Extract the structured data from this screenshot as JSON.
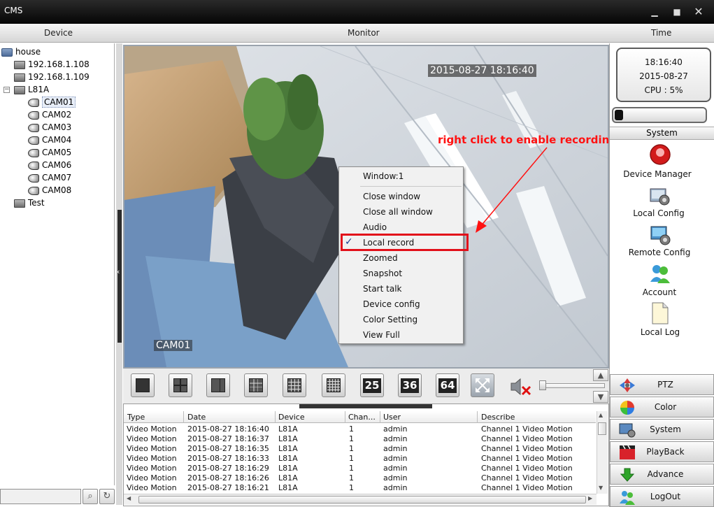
{
  "window": {
    "title": "CMS"
  },
  "headers": {
    "device": "Device",
    "monitor": "Monitor",
    "time": "Time"
  },
  "tree": {
    "root": "house",
    "devices": [
      "192.168.1.108",
      "192.168.1.109"
    ],
    "group": "L81A",
    "cameras": [
      "CAM01",
      "CAM02",
      "CAM03",
      "CAM04",
      "CAM05",
      "CAM06",
      "CAM07",
      "CAM08"
    ],
    "other": "Test",
    "selected": "CAM01"
  },
  "video": {
    "timestamp": "2015-08-27 18:16:40",
    "camera_label": "CAM01"
  },
  "context_menu": {
    "items": [
      "Window:1",
      "Close window",
      "Close all window",
      "Audio",
      "Local record",
      "Zoomed",
      "Snapshot",
      "Start talk",
      "Device config",
      "Color Setting",
      "View Full"
    ],
    "checked": "Local record",
    "check_glyph": "✓"
  },
  "annotation": {
    "text": "right click to enable recording",
    "color": "#ff1111"
  },
  "layout_buttons": {
    "numbered": [
      "25",
      "36",
      "64"
    ]
  },
  "log": {
    "columns": [
      "Type",
      "Date",
      "Device",
      "Chan...",
      "User",
      "Describe"
    ],
    "rows": [
      [
        "Video Motion",
        "2015-08-27 18:16:40",
        "L81A",
        "1",
        "admin",
        "Channel 1 Video Motion"
      ],
      [
        "Video Motion",
        "2015-08-27 18:16:37",
        "L81A",
        "1",
        "admin",
        "Channel 1 Video Motion"
      ],
      [
        "Video Motion",
        "2015-08-27 18:16:35",
        "L81A",
        "1",
        "admin",
        "Channel 1 Video Motion"
      ],
      [
        "Video Motion",
        "2015-08-27 18:16:33",
        "L81A",
        "1",
        "admin",
        "Channel 1 Video Motion"
      ],
      [
        "Video Motion",
        "2015-08-27 18:16:29",
        "L81A",
        "1",
        "admin",
        "Channel 1 Video Motion"
      ],
      [
        "Video Motion",
        "2015-08-27 18:16:26",
        "L81A",
        "1",
        "admin",
        "Channel 1 Video Motion"
      ],
      [
        "Video Motion",
        "2015-08-27 18:16:21",
        "L81A",
        "1",
        "admin",
        "Channel 1 Video Motion"
      ]
    ]
  },
  "clock": {
    "time": "18:16:40",
    "date": "2015-08-27",
    "cpu": "CPU : 5%",
    "cpu_fraction": 0.05
  },
  "system_panel": {
    "header": "System",
    "items": [
      "Device Manager",
      "Local Config",
      "Remote Config",
      "Account",
      "Local Log"
    ]
  },
  "bottom_buttons": [
    "PTZ",
    "Color",
    "System",
    "PlayBack",
    "Advance",
    "LogOut"
  ],
  "colors": {
    "highlight": "#e2101a",
    "annotation": "#ff1111",
    "titlebar": "#111111"
  }
}
